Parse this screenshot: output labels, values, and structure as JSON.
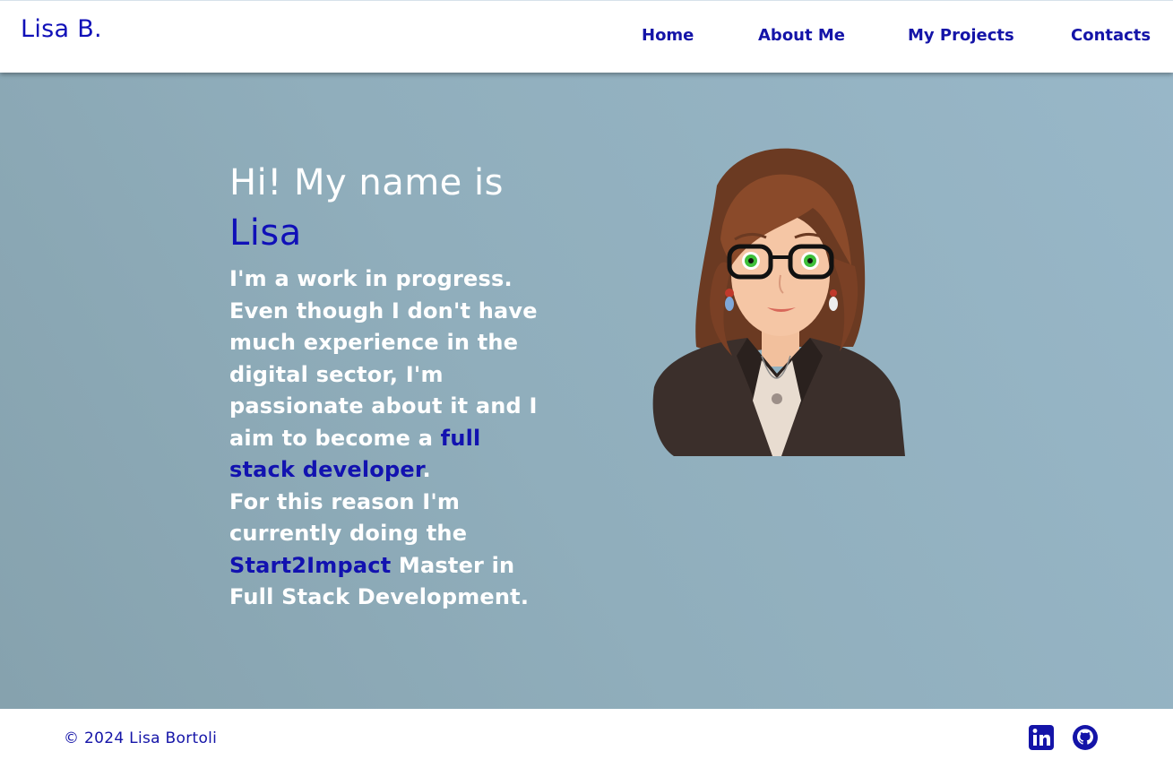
{
  "nav": {
    "brand": "Lisa B.",
    "links": [
      "Home",
      "About Me",
      "My Projects",
      "Contacts"
    ]
  },
  "hero": {
    "greeting": "Hi! My name is",
    "name": "Lisa",
    "intro_1": "I'm a work in progress. Even though I don't have much experience in the digital sector, I'm passionate about it and I aim to become a ",
    "intro_link_1": "full stack developer",
    "intro_2": ".",
    "intro_3": "For this reason I'm currently doing the ",
    "intro_link_2": "Start2Impact",
    "intro_4": " Master in Full Stack Development."
  },
  "footer": {
    "copyright": "© 2024 Lisa Bortoli",
    "social_icons": [
      "linkedin-icon",
      "github-icon"
    ]
  },
  "colors": {
    "accent": "#1010b8",
    "hero_bg": "#90aebc",
    "text_light": "#ffffff"
  }
}
